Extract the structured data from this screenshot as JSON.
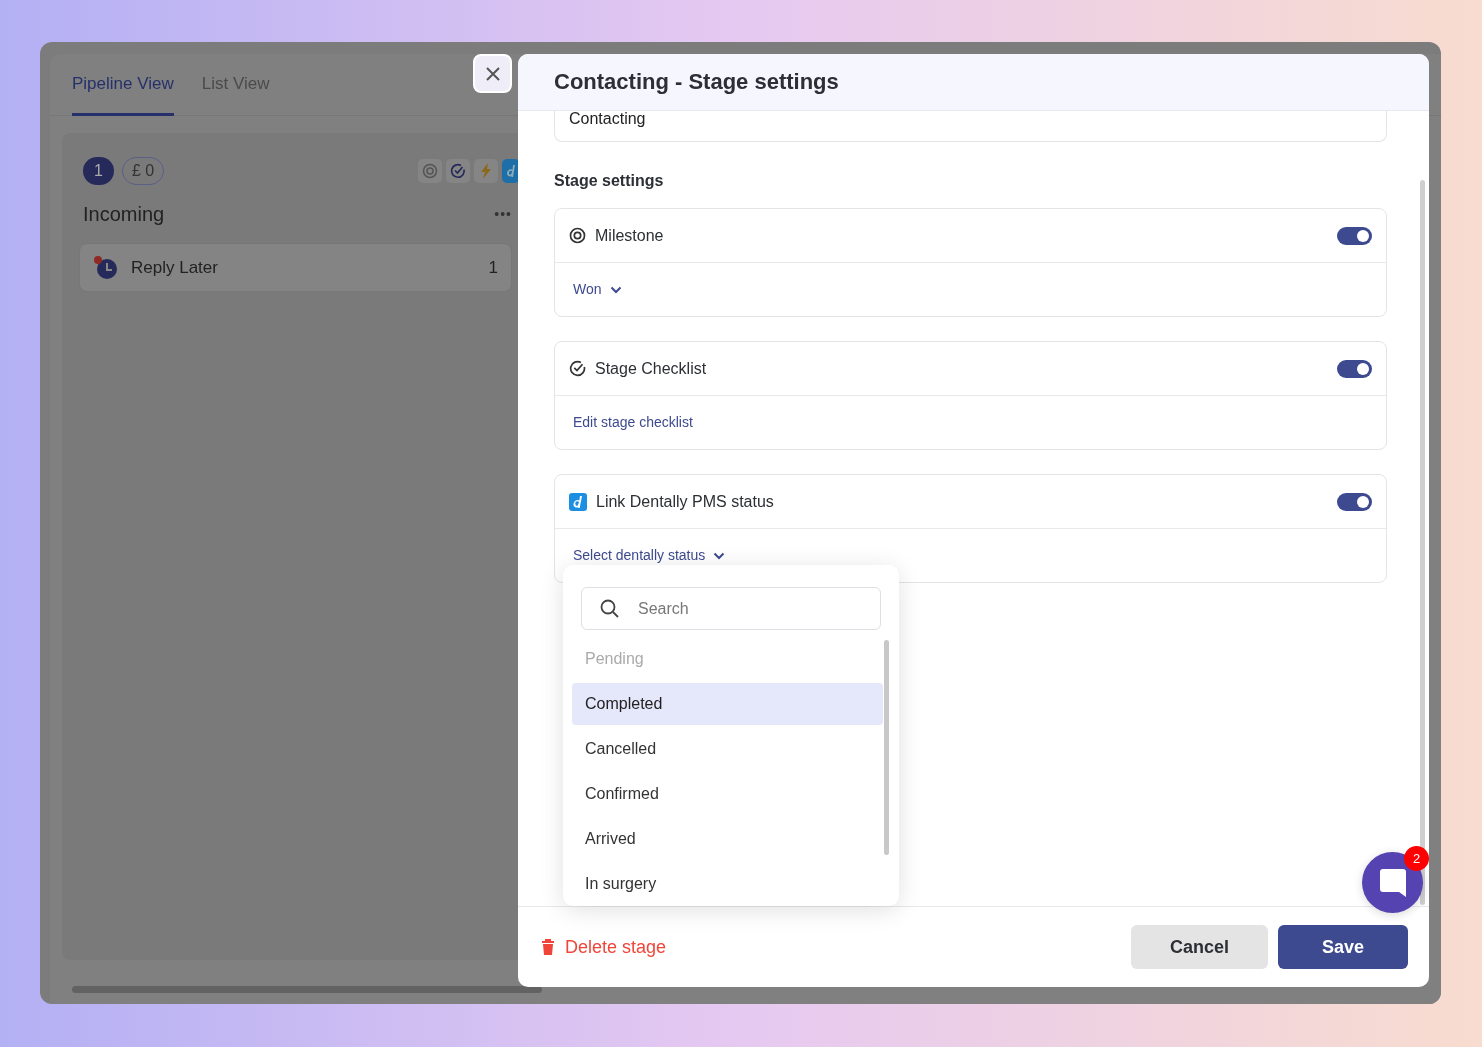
{
  "tabs": [
    {
      "label": "Pipeline View",
      "selected": true
    },
    {
      "label": "List View",
      "selected": false
    }
  ],
  "column": {
    "count": "1",
    "value": "£ 0",
    "title": "Incoming",
    "more": "•••",
    "cards": [
      {
        "label": "Reply Later",
        "count": "1"
      }
    ]
  },
  "modal": {
    "title": "Contacting - Stage settings",
    "stage_name": "Contacting",
    "section_title": "Stage settings",
    "settings": [
      {
        "kind": "milestone",
        "label": "Milestone",
        "on": true,
        "action": {
          "kind": "dropdown",
          "label": "Won"
        }
      },
      {
        "kind": "checklist",
        "label": "Stage Checklist",
        "on": true,
        "action": {
          "kind": "link",
          "label": "Edit stage checklist"
        }
      },
      {
        "kind": "dentally",
        "label": "Link Dentally PMS status",
        "on": true,
        "action": {
          "kind": "dropdown",
          "label": "Select dentally status"
        }
      }
    ],
    "dropdown": {
      "placeholder": "Search",
      "options": [
        {
          "label": "Pending",
          "disabled": true,
          "selected": false
        },
        {
          "label": "Completed",
          "disabled": false,
          "selected": true
        },
        {
          "label": "Cancelled",
          "disabled": false,
          "selected": false
        },
        {
          "label": "Confirmed",
          "disabled": false,
          "selected": false
        },
        {
          "label": "Arrived",
          "disabled": false,
          "selected": false
        },
        {
          "label": "In surgery",
          "disabled": false,
          "selected": false
        }
      ]
    },
    "delete_label": "Delete stage",
    "buttons": [
      {
        "label": "Cancel",
        "kind": "secondary"
      },
      {
        "label": "Save",
        "kind": "primary"
      }
    ]
  },
  "chat": {
    "badge": "2"
  }
}
